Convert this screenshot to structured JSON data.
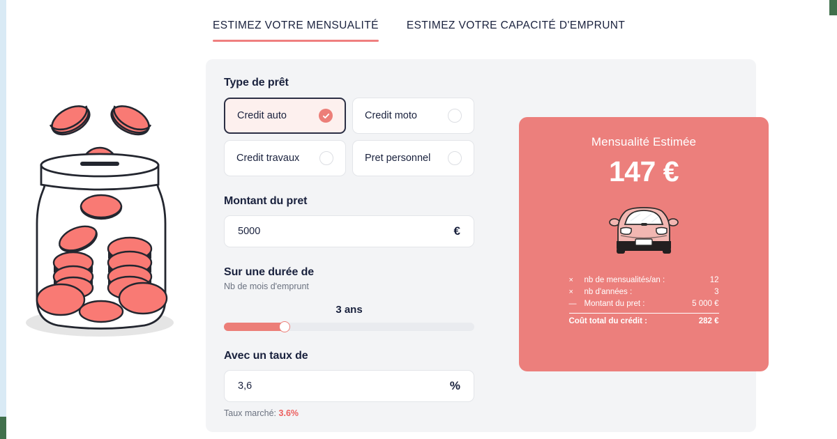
{
  "tabs": [
    {
      "label": "ESTIMEZ VOTRE MENSUALITÉ",
      "active": true
    },
    {
      "label": "ESTIMEZ VOTRE CAPACITÉ D'EMPRUNT",
      "active": false
    }
  ],
  "form": {
    "loan_type_label": "Type de prêt",
    "loan_types": [
      {
        "label": "Credit auto",
        "selected": true
      },
      {
        "label": "Credit moto",
        "selected": false
      },
      {
        "label": "Credit travaux",
        "selected": false
      },
      {
        "label": "Pret personnel",
        "selected": false
      }
    ],
    "amount_label": "Montant du pret",
    "amount_value": "5000",
    "amount_unit": "€",
    "duration_label": "Sur une durée de",
    "duration_sublabel": "Nb de mois d'emprunt",
    "duration_value": "3 ans",
    "duration_percent": 26,
    "rate_label": "Avec un taux de",
    "rate_value": "3,6",
    "rate_unit": "%",
    "market_rate_prefix": "Taux marché: ",
    "market_rate_value": "3.6%"
  },
  "result": {
    "title": "Mensualité Estimée",
    "amount": "147 €",
    "rows": [
      {
        "op": "×",
        "key": "nb de mensualités/an :",
        "value": "12"
      },
      {
        "op": "×",
        "key": "nb d'années :",
        "value": "3"
      },
      {
        "op": "—",
        "key": "Montant du pret :",
        "value": "5 000 €"
      }
    ],
    "total_label": "Coût total du crédit :",
    "total_value": "282 €"
  },
  "colors": {
    "accent": "#ec7f7c",
    "accent_strong": "#ec5f5f",
    "panel_bg": "#f3f4f6",
    "text": "#19213d",
    "edge_blue": "#d9eaf5",
    "edge_green": "#41704c"
  },
  "illustration": {
    "left": "coin-jar-illustration",
    "card": "car-front-illustration"
  }
}
